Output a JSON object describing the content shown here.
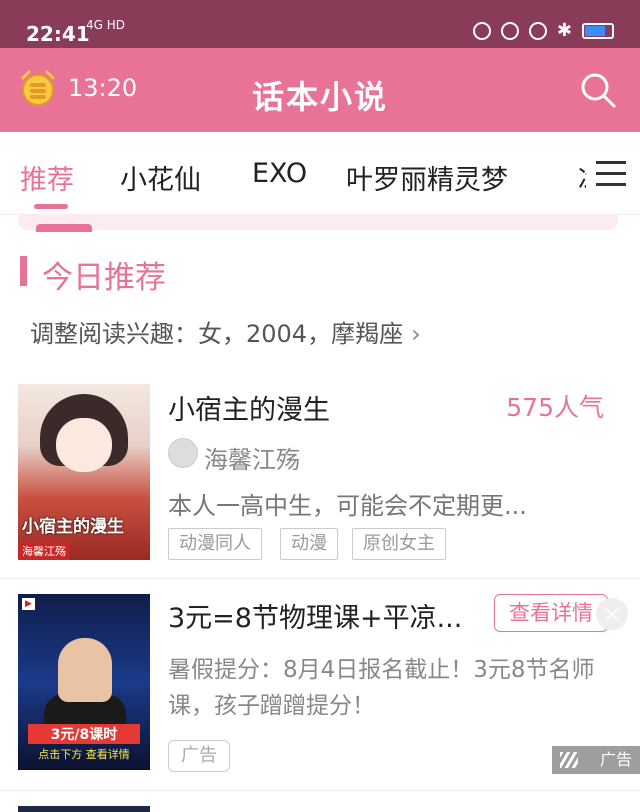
{
  "status_bar": {
    "time": "22:41",
    "network": "4G HD"
  },
  "header": {
    "time": "13:20",
    "title": "话本小说"
  },
  "tabs": [
    "推荐",
    "小花仙",
    "EXO",
    "叶罗丽精灵梦",
    "冰"
  ],
  "section": {
    "title": "今日推荐",
    "preferences": "调整阅读兴趣：女，2004，摩羯座"
  },
  "book": {
    "title": "小宿主的漫生",
    "popularity": "575人气",
    "author": "海馨江殇",
    "description": "本人一高中生，可能会不定期更...",
    "tags": [
      "动漫同人",
      "动漫",
      "原创女主"
    ],
    "cover_text": "小宿主的漫生",
    "cover_author": "海馨江殇"
  },
  "ad": {
    "title": "3元=8节物理课+平凉...",
    "button": "查看详情",
    "description": "暑假提分：8月4日报名截止！3元8节名师课，孩子蹭蹭提分！",
    "tag": "广告",
    "label": "广告",
    "cover_price": "3元/8课时",
    "cover_cta": "点击下方 查看详情"
  },
  "colors": {
    "accent": "#e97397",
    "status_bar": "#8a3b57"
  }
}
